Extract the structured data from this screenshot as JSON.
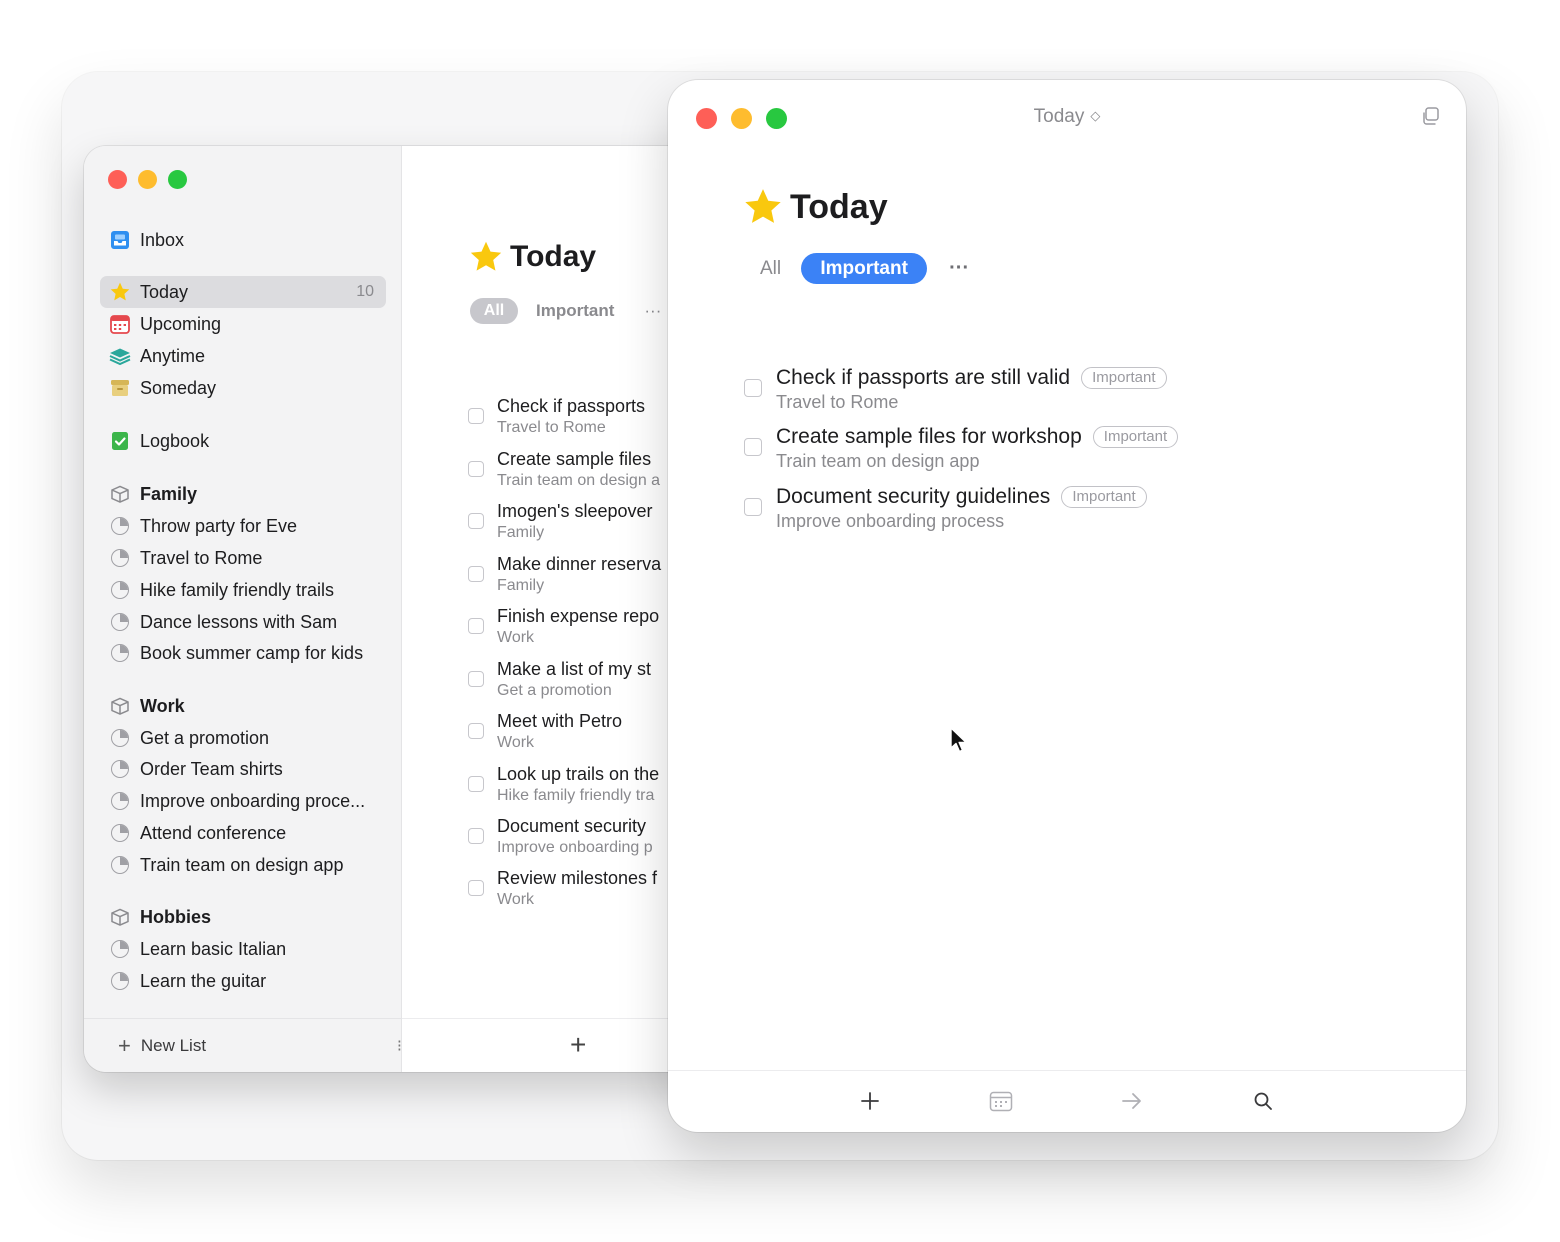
{
  "sidebar": {
    "inbox": "Inbox",
    "today": "Today",
    "today_count": "10",
    "upcoming": "Upcoming",
    "anytime": "Anytime",
    "someday": "Someday",
    "logbook": "Logbook",
    "areas": [
      {
        "name": "Family",
        "projects": [
          "Throw party for Eve",
          "Travel to Rome",
          "Hike family friendly trails",
          "Dance lessons with Sam",
          "Book summer camp for kids"
        ]
      },
      {
        "name": "Work",
        "projects": [
          "Get a promotion",
          "Order Team shirts",
          "Improve onboarding proce...",
          "Attend conference",
          "Train team on design app"
        ]
      },
      {
        "name": "Hobbies",
        "projects": [
          "Learn basic Italian",
          "Learn the guitar"
        ]
      }
    ],
    "new_list": "New List"
  },
  "back_window": {
    "title": "Today",
    "filters": {
      "all": "All",
      "important": "Important",
      "more": "···"
    },
    "tasks": [
      {
        "title": "Check if passports",
        "subtitle": "Travel to Rome"
      },
      {
        "title": "Create sample files",
        "subtitle": "Train team on design a"
      },
      {
        "title": "Imogen's sleepover",
        "subtitle": "Family"
      },
      {
        "title": "Make dinner reserva",
        "subtitle": "Family"
      },
      {
        "title": "Finish expense repo",
        "subtitle": "Work"
      },
      {
        "title": "Make a list of my st",
        "subtitle": "Get a promotion"
      },
      {
        "title": "Meet with Petro",
        "subtitle": "Work"
      },
      {
        "title": "Look up trails on the",
        "subtitle": "Hike family friendly tra"
      },
      {
        "title": "Document security",
        "subtitle": "Improve onboarding p"
      },
      {
        "title": "Review milestones f",
        "subtitle": "Work"
      }
    ],
    "add": "+"
  },
  "front_window": {
    "header_title": "Today",
    "header_chevron": "◇",
    "title": "Today",
    "filters": {
      "all": "All",
      "important": "Important",
      "more": "···"
    },
    "tasks": [
      {
        "title": "Check if passports are still valid",
        "tag": "Important",
        "subtitle": "Travel to Rome"
      },
      {
        "title": "Create sample files for workshop",
        "tag": "Important",
        "subtitle": "Train team on design app"
      },
      {
        "title": "Document security guidelines",
        "tag": "Important",
        "subtitle": "Improve onboarding process"
      }
    ],
    "footer_icons": [
      "plus-icon",
      "calendar-icon",
      "arrow-right-icon",
      "search-icon"
    ]
  },
  "colors": {
    "accent": "#3b82f6",
    "star": "#f9c80e",
    "traffic_red": "#fe5f57",
    "traffic_yellow": "#febc2e",
    "traffic_green": "#28c840"
  }
}
